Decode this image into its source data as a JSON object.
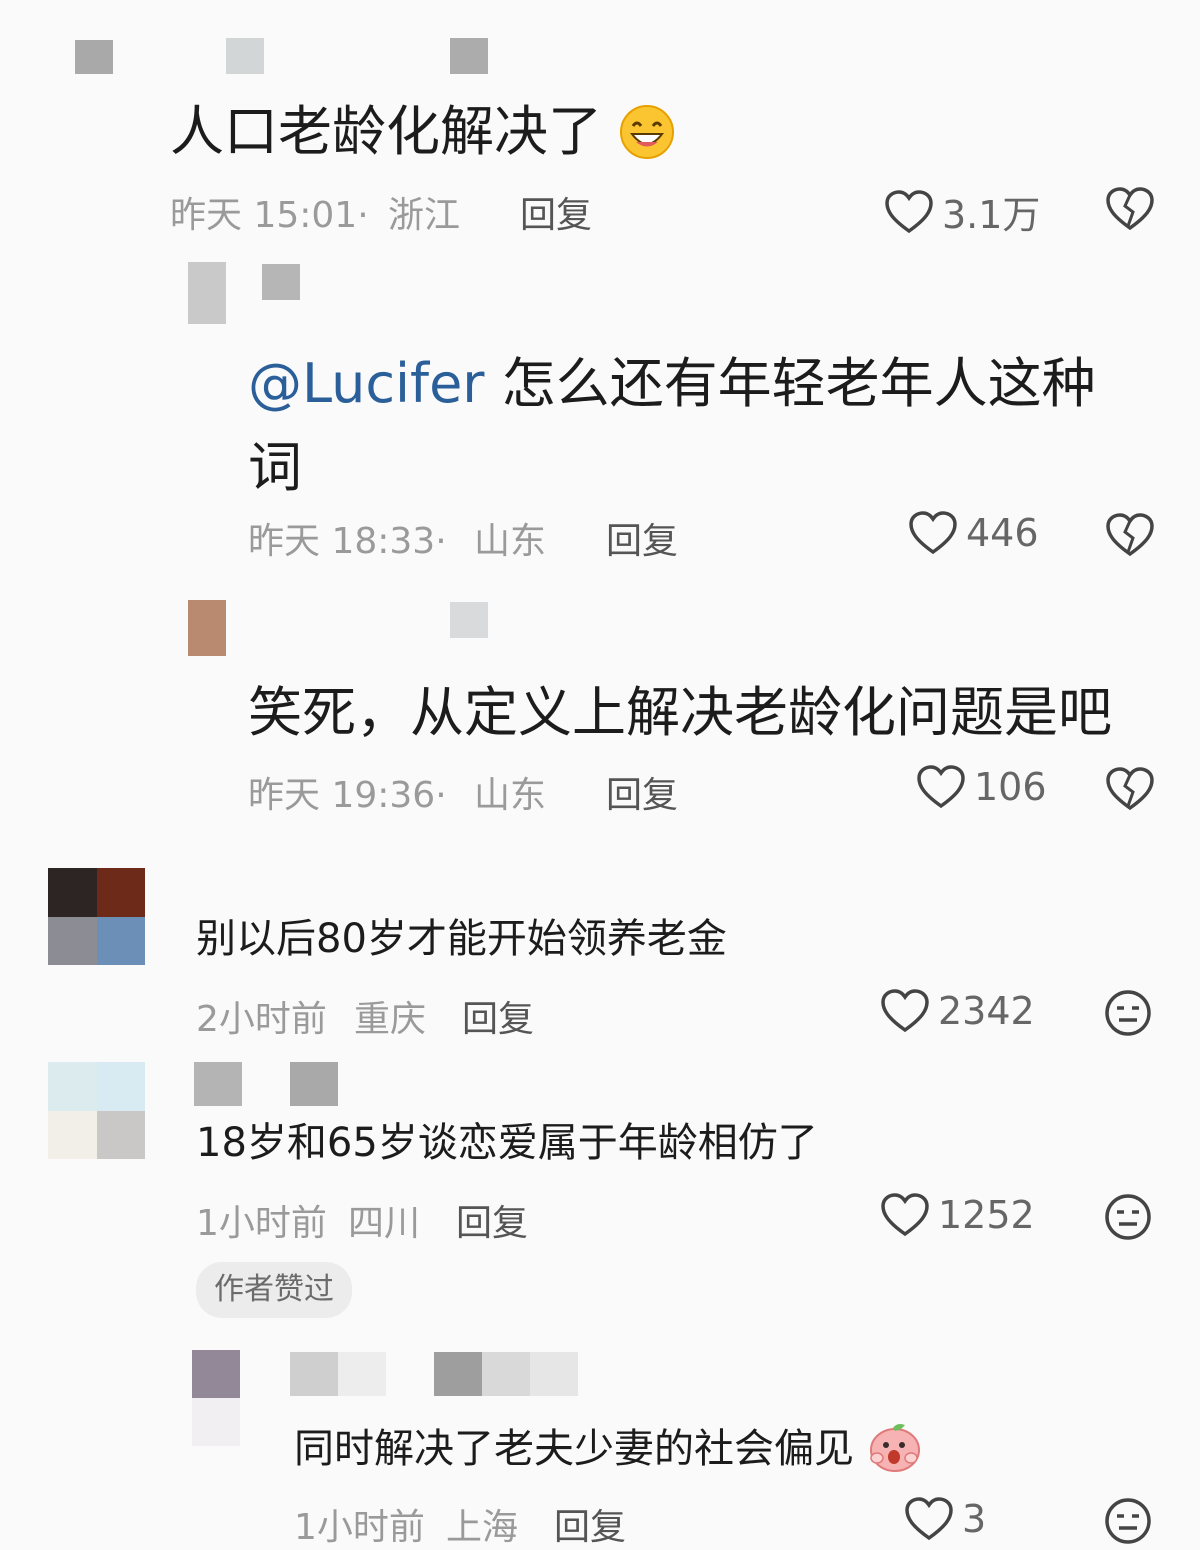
{
  "comments": [
    {
      "text": "人口老龄化解决了",
      "emoji": "grinning-face-emoji",
      "time": "昨天 15:01·",
      "location": "浙江",
      "reply": "回复",
      "likes": "3.1万",
      "action_icon": "broken-heart-icon"
    },
    {
      "mention": "@Lucifer",
      "text_line1": " 怎么还有年轻老年人这种",
      "text_line2": "词",
      "time": "昨天 18:33·",
      "location": "山东",
      "reply": "回复",
      "likes": "446",
      "action_icon": "broken-heart-icon"
    },
    {
      "text": "笑死，从定义上解决老龄化问题是吧",
      "time": "昨天 19:36·",
      "location": "山东",
      "reply": "回复",
      "likes": "106",
      "action_icon": "broken-heart-icon"
    },
    {
      "text": "别以后80岁才能开始领养老金",
      "time": "2小时前",
      "location": "重庆",
      "reply": "回复",
      "likes": "2342",
      "action_icon": "neutral-face-icon"
    },
    {
      "text": "18岁和65岁谈恋爱属于年龄相仿了",
      "time": "1小时前",
      "location": "四川",
      "reply": "回复",
      "likes": "1252",
      "action_icon": "neutral-face-icon",
      "badge": "作者赞过"
    },
    {
      "text": "同时解决了老夫少妻的社会偏见",
      "emoji": "shocked-peach-emoji",
      "time": "1小时前",
      "location": "上海",
      "reply": "回复",
      "likes": "3",
      "action_icon": "neutral-face-icon"
    }
  ],
  "colors": {
    "mention": "#2a5f99",
    "meta": "#9a9a9a",
    "badge_bg": "#ececec"
  }
}
